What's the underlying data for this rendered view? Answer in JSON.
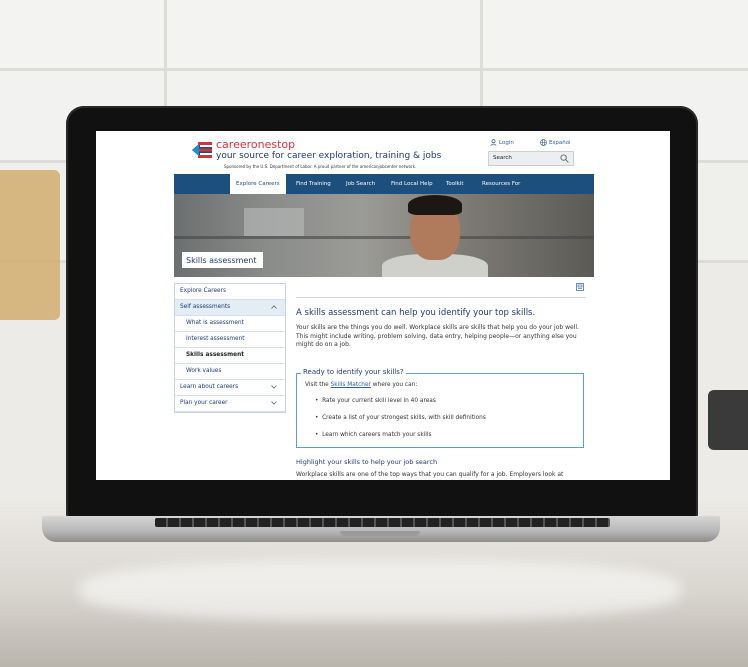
{
  "header": {
    "brand": "careeronestop",
    "tagline": "your source for career exploration, training & jobs",
    "sponsor": "Sponsored by the U.S. Department of Labor.  A proud partner of the americanjobcenter network.",
    "login_label": "Login",
    "language_label": "Español",
    "search_placeholder": "Search"
  },
  "nav": {
    "items": [
      "Explore Careers",
      "Find Training",
      "Job Search",
      "Find Local Help",
      "Toolkit",
      "Resources For"
    ],
    "active": "Explore Careers"
  },
  "hero": {
    "tab_label": "Skills assessment"
  },
  "sidebar": {
    "items": [
      {
        "label": "Explore Careers"
      },
      {
        "label": "Self assessments"
      },
      {
        "label": "What is assessment"
      },
      {
        "label": "Interest assessment"
      },
      {
        "label": "Skills assessment"
      },
      {
        "label": "Work values"
      },
      {
        "label": "Learn about careers"
      },
      {
        "label": "Plan your career"
      }
    ]
  },
  "content": {
    "heading": "A skills assessment can help you identify your top skills.",
    "intro": "Your skills are the things you do well. Workplace skills are skills that help you do your job well. This might include writing, problem solving, data entry, helping people—or anything else you might do on a job.",
    "box_title": "Ready to identify your skills?",
    "box_lead_prefix": "Visit the ",
    "box_link": "Skills Matcher",
    "box_lead_suffix": " where you can:",
    "bullets": [
      "Rate your current skill level in 40 areas",
      "Create a list of your strongest skills, with skill definitions",
      "Learn which careers match your skills"
    ],
    "subheading": "Highlight your skills to help your job search",
    "para2": "Workplace skills are one of the top ways that you can qualify for a job. Employers look at"
  },
  "colors": {
    "nav_bg": "#1d4f7c",
    "brand_red": "#d2363a",
    "link_blue": "#2a5fa0",
    "box_border": "#5ea0c9"
  }
}
